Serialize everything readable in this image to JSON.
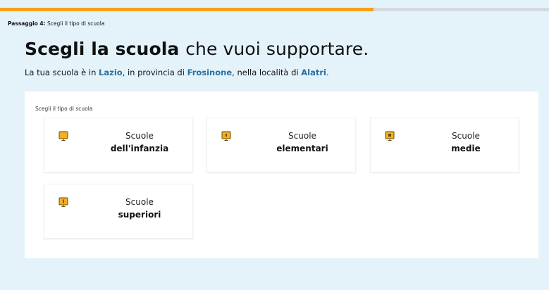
{
  "progress": {
    "fraction": 0.68
  },
  "step": {
    "prefix": "Passaggio 4:",
    "text": "Scegli il tipo di scuola"
  },
  "headline": {
    "bold": "Scegli la scuola",
    "rest": "che vuoi supportare."
  },
  "location": {
    "t1": "La tua scuola è in ",
    "region": "Lazio",
    "t2": ", in provincia di ",
    "province": "Frosinone",
    "t3": ", nella località di ",
    "town": "Alatri",
    "t4": "."
  },
  "panel": {
    "label": "Scegli il tipo di scuola"
  },
  "cards": [
    {
      "line1": "Scuole",
      "line2": "dell'infanzia",
      "icon": "school-board-icon"
    },
    {
      "line1": "Scuole",
      "line2": "elementari",
      "icon": "school-board-icon"
    },
    {
      "line1": "Scuole",
      "line2": "medie",
      "icon": "school-board-icon"
    },
    {
      "line1": "Scuole",
      "line2": "superiori",
      "icon": "school-board-icon"
    }
  ],
  "colors": {
    "accent": "#f7a019",
    "link": "#2a6f9f",
    "background": "#e4f3fa",
    "icon": "#f2b01e"
  }
}
